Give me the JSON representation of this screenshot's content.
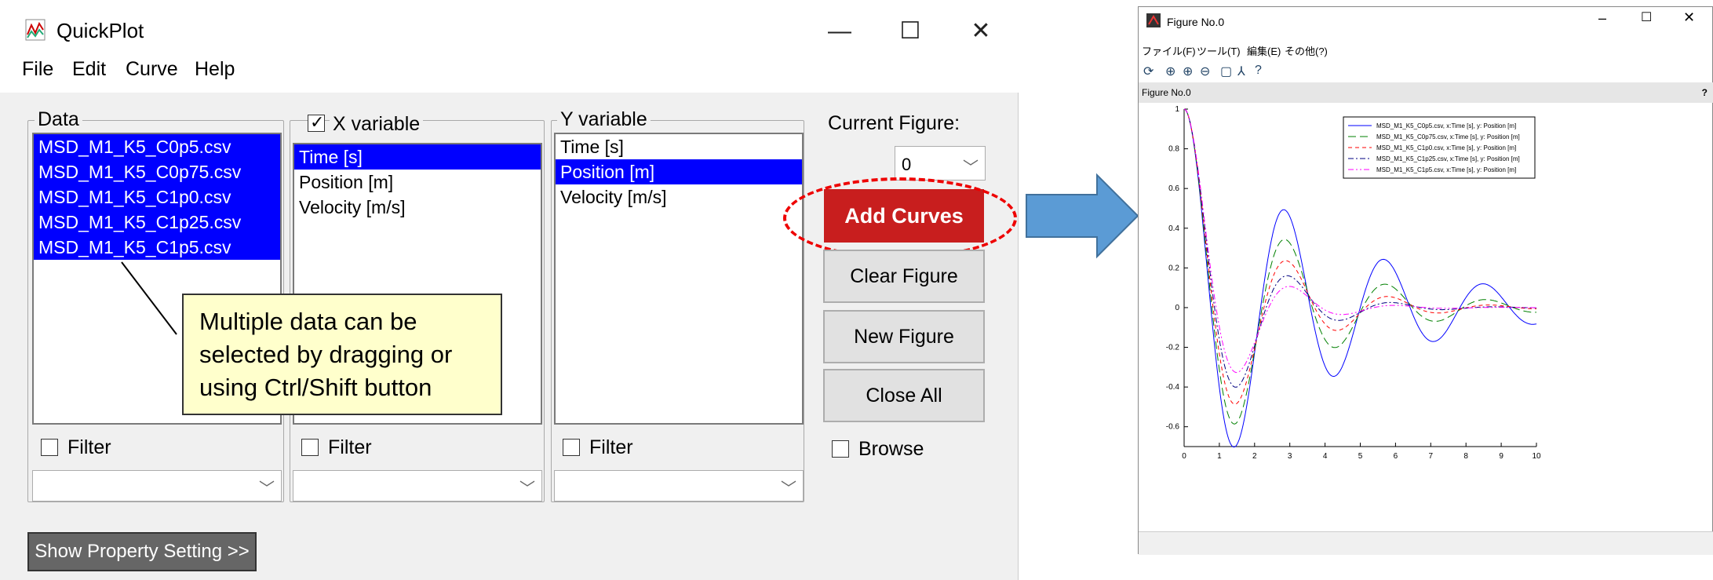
{
  "app": {
    "title": "QuickPlot",
    "menu": [
      "File",
      "Edit",
      "Curve",
      "Help"
    ],
    "window_controls": {
      "minimize": "—",
      "maximize": "☐",
      "close": "✕"
    }
  },
  "data_panel": {
    "legend": "Data",
    "items": [
      {
        "label": "MSD_M1_K5_C0p5.csv",
        "selected": true
      },
      {
        "label": "MSD_M1_K5_C0p75.csv",
        "selected": true
      },
      {
        "label": "MSD_M1_K5_C1p0.csv",
        "selected": true
      },
      {
        "label": "MSD_M1_K5_C1p25.csv",
        "selected": true
      },
      {
        "label": "MSD_M1_K5_C1p5.csv",
        "selected": true
      }
    ],
    "filter_label": "Filter"
  },
  "x_panel": {
    "legend": "X variable",
    "checked": true,
    "items": [
      {
        "label": "Time [s]",
        "selected": true
      },
      {
        "label": "Position [m]",
        "selected": false
      },
      {
        "label": "Velocity [m/s]",
        "selected": false
      }
    ],
    "filter_label": "Filter"
  },
  "y_panel": {
    "legend": "Y variable",
    "items": [
      {
        "label": "Time [s]",
        "selected": false
      },
      {
        "label": "Position [m]",
        "selected": true
      },
      {
        "label": "Velocity [m/s]",
        "selected": false
      }
    ],
    "filter_label": "Filter"
  },
  "right_panel": {
    "current_figure_label": "Current Figure:",
    "current_figure_value": "0",
    "add_curves": "Add Curves",
    "clear_figure": "Clear Figure",
    "new_figure": "New Figure",
    "close_all": "Close All",
    "browse_label": "Browse"
  },
  "callout": {
    "text": "Multiple data can be selected by dragging or using Ctrl/Shift button"
  },
  "show_property": "Show Property Setting >>",
  "colors": {
    "selection": "#0000ff",
    "accent_red": "#c81e1e",
    "arrow": "#5b9bd5",
    "callout_bg": "#ffffcc"
  },
  "figure_window": {
    "title": "Figure No.0",
    "menu": [
      "ファイル(F)",
      "ツール(T)",
      "編集(E)",
      "その他(?)"
    ],
    "figure_bar_label": "Figure No.0",
    "help_mark": "?"
  },
  "chart_data": {
    "type": "line",
    "title": "",
    "xlabel": "",
    "ylabel": "",
    "xlim": [
      0,
      10
    ],
    "ylim": [
      -0.7,
      1
    ],
    "xticks": [
      "0",
      "1",
      "2",
      "3",
      "4",
      "5",
      "6",
      "7",
      "8",
      "9",
      "10"
    ],
    "yticks": [
      "1",
      "0.8",
      "0.6",
      "0.4",
      "0.2",
      "0",
      "-0.2",
      "-0.4",
      "-0.6"
    ],
    "legend_position": "top-right",
    "series": [
      {
        "name": "MSD_M1_K5_C0p5.csv, x:Time [s], y: Position [m]",
        "color": "#0000ff",
        "dash": "solid",
        "c": 0.5
      },
      {
        "name": "MSD_M1_K5_C0p75.csv, x:Time [s], y: Position [m]",
        "color": "#008000",
        "dash": "long-dash",
        "c": 0.75
      },
      {
        "name": "MSD_M1_K5_C1p0.csv, x:Time [s], y: Position [m]",
        "color": "#ff0000",
        "dash": "dashed",
        "c": 1.0
      },
      {
        "name": "MSD_M1_K5_C1p25.csv, x:Time [s], y: Position [m]",
        "color": "#000080",
        "dash": "dash-dot",
        "c": 1.25
      },
      {
        "name": "MSD_M1_K5_C1p5.csv, x:Time [s], y: Position [m]",
        "color": "#ff00ff",
        "dash": "dash-dot-dot",
        "c": 1.5
      }
    ]
  }
}
